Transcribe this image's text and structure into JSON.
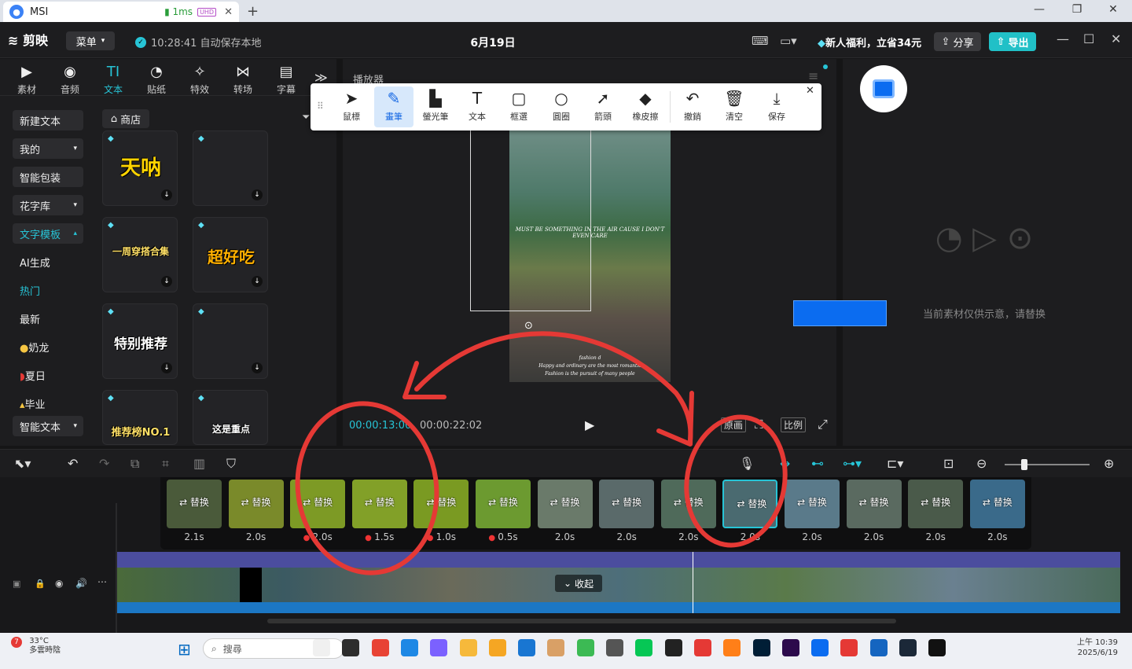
{
  "browser": {
    "tab_title": "MSI",
    "latency": "1ms",
    "uhd_badge": "UHD"
  },
  "app": {
    "logo": "剪映",
    "menu_label": "菜单",
    "save_status": "10:28:41 自动保存本地",
    "project_title": "6月19日",
    "promo": "新人福利，立省34元",
    "share_label": "分享",
    "export_label": "导出"
  },
  "left_tools": [
    {
      "icon": "media-icon",
      "label": "素材"
    },
    {
      "icon": "audio-icon",
      "label": "音频"
    },
    {
      "icon": "text-icon",
      "label": "文本"
    },
    {
      "icon": "sticker-icon",
      "label": "贴纸"
    },
    {
      "icon": "effects-icon",
      "label": "特效"
    },
    {
      "icon": "transition-icon",
      "label": "转场"
    },
    {
      "icon": "subtitle-icon",
      "label": "字幕"
    }
  ],
  "sidebar": {
    "new_text": "新建文本",
    "mine": "我的",
    "smart_pack": "智能包装",
    "font_lib": "花字库",
    "text_template": "文字模板",
    "ai_gen": "AI生成",
    "hot": "热门",
    "latest": "最新",
    "milk_tea": "奶龙",
    "summer": "夏日",
    "graduate": "毕业",
    "smart_text": "智能文本"
  },
  "store_label": "商店",
  "templates": [
    "天呐",
    "",
    "一周穿搭合集",
    "超好吃",
    "特别推荐",
    "",
    "推荐榜NO.1",
    "这是重点"
  ],
  "player": {
    "title": "播放器",
    "caption_main": "MUST BE SOMETHING IN THE AIR CAUSE I DON'T EVEN CARE",
    "caption_small_1": "fashion d",
    "caption_small_2": "Happy and ordinary are the most romantic",
    "caption_small_3": "Fashion is the pursuit of many people",
    "current_time": "00:00:13:00",
    "total_time": "00:00:22:02",
    "original_btn": "原画",
    "ratio_btn": "比例"
  },
  "annotation_tools": [
    {
      "icon": "cursor-icon",
      "label": "鼠標"
    },
    {
      "icon": "pen-icon",
      "label": "畫筆"
    },
    {
      "icon": "highlighter-icon",
      "label": "螢光筆"
    },
    {
      "icon": "text-tool-icon",
      "label": "文本"
    },
    {
      "icon": "rectangle-icon",
      "label": "框選"
    },
    {
      "icon": "circle-icon",
      "label": "圓圈"
    },
    {
      "icon": "arrow-icon",
      "label": "箭頭"
    },
    {
      "icon": "eraser-icon",
      "label": "橡皮擦"
    },
    {
      "icon": "undo-icon",
      "label": "撤銷"
    },
    {
      "icon": "trash-icon",
      "label": "清空"
    },
    {
      "icon": "save-icon",
      "label": "保存"
    }
  ],
  "right_panel": {
    "placeholder_note": "当前素材仅供示意，请替换"
  },
  "clips": [
    {
      "label": "替换",
      "duration": "2.1s",
      "dot": false,
      "color": "#4a5a3a"
    },
    {
      "label": "替换",
      "duration": "2.0s",
      "dot": false,
      "color": "#7a8a2a"
    },
    {
      "label": "替换",
      "duration": "2.0s",
      "dot": true,
      "color": "#7d9a25"
    },
    {
      "label": "替换",
      "duration": "1.5s",
      "dot": true,
      "color": "#82a028"
    },
    {
      "label": "替换",
      "duration": "1.0s",
      "dot": true,
      "color": "#7a9a22"
    },
    {
      "label": "替换",
      "duration": "0.5s",
      "dot": true,
      "color": "#6c9a30"
    },
    {
      "label": "替换",
      "duration": "2.0s",
      "dot": false,
      "color": "#6a7a6a"
    },
    {
      "label": "替换",
      "duration": "2.0s",
      "dot": false,
      "color": "#5a6a6a"
    },
    {
      "label": "替换",
      "duration": "2.0s",
      "dot": false,
      "color": "#4f6a5a"
    },
    {
      "label": "替换",
      "duration": "2.0s",
      "dot": false,
      "color": "#4a6a70"
    },
    {
      "label": "替换",
      "duration": "2.0s",
      "dot": false,
      "color": "#5a7a8a"
    },
    {
      "label": "替换",
      "duration": "2.0s",
      "dot": false,
      "color": "#5a6a60"
    },
    {
      "label": "替换",
      "duration": "2.0s",
      "dot": false,
      "color": "#4a5a4a"
    },
    {
      "label": "替换",
      "duration": "2.0s",
      "dot": false,
      "color": "#3a6a8a"
    }
  ],
  "track": {
    "collapse_label": "收起"
  },
  "taskbar": {
    "weather_temp": "33°C",
    "weather_desc": "多雲時陰",
    "notif": "7",
    "search_placeholder": "搜尋",
    "time": "上午 10:39",
    "date": "2025/6/19",
    "apps": [
      "#f0f0f0",
      "#2d2d2d",
      "#e84335",
      "#1e88e5",
      "#7b61ff",
      "#f6b93b",
      "#f5a623",
      "#1976d2",
      "#d9a066",
      "#3cba54",
      "#555555",
      "#06c755",
      "#222222",
      "#e53935",
      "#ff7f18",
      "#001e36",
      "#2c0a4c",
      "#0b6cf0",
      "#e53935",
      "#1565c0",
      "#1b2838",
      "#111111"
    ]
  },
  "colors": {
    "accent": "#27c4d6",
    "annotation_red": "#e53935",
    "export_button": "#21c0c7"
  }
}
